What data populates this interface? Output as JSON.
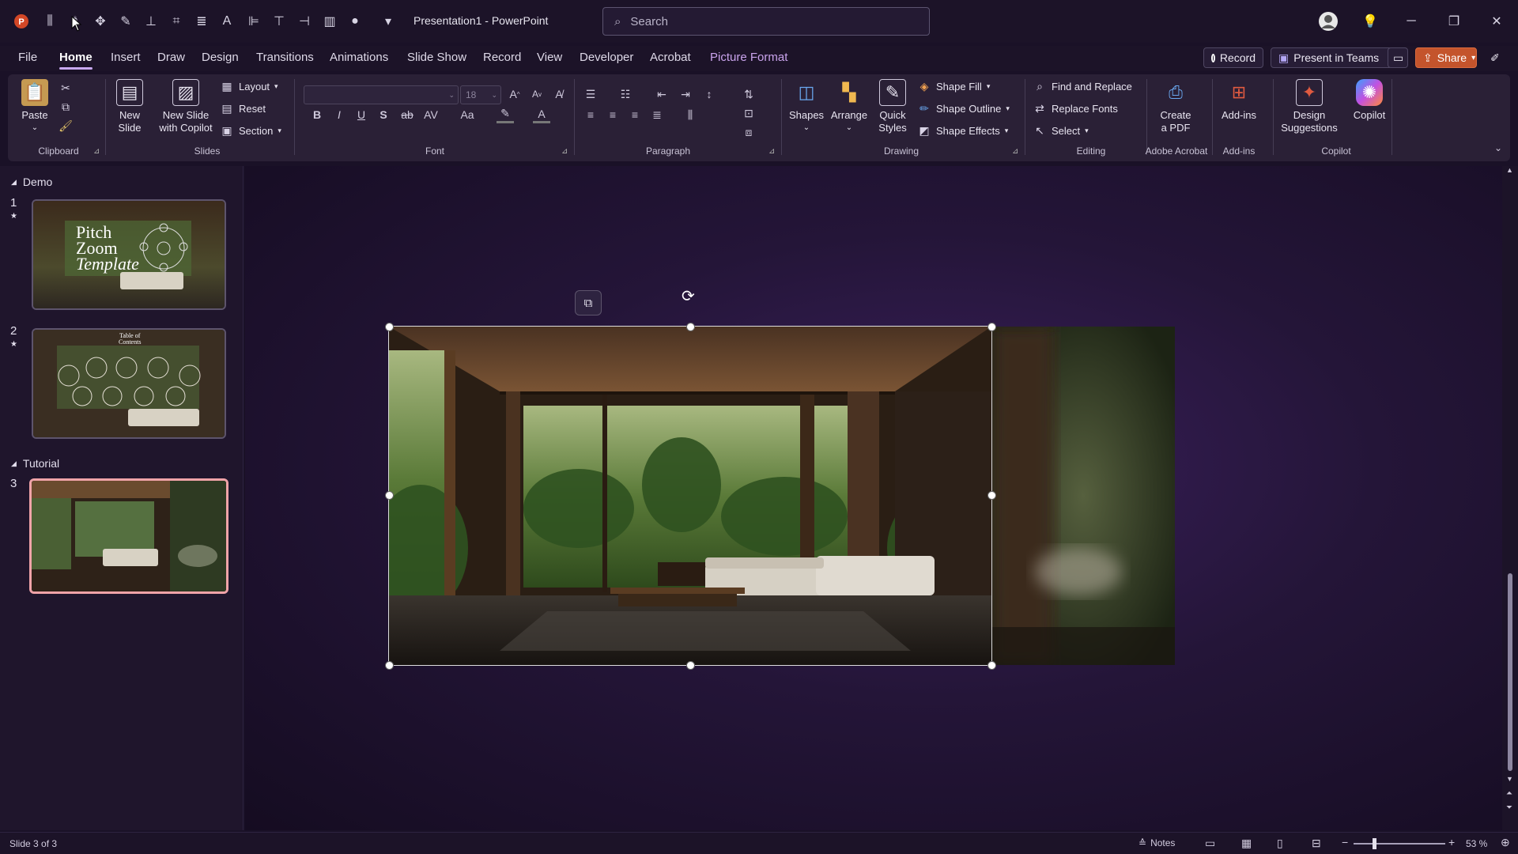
{
  "app": {
    "doc_title": "Presentation1 - PowerPoint",
    "search_placeholder": "Search",
    "brand_color": "#c4542c"
  },
  "quick_access": [
    "powerpoint-logo",
    "distribute-icon",
    "align-icon",
    "move-icon",
    "format-icon",
    "align-bottom-icon",
    "crop-icon",
    "text-align-icon",
    "text-icon",
    "align-left-icon",
    "align-top-icon",
    "align-right-icon",
    "chart-icon",
    "shape-icon",
    "customize-icon"
  ],
  "tabs": {
    "file": "File",
    "home": "Home",
    "insert": "Insert",
    "draw": "Draw",
    "design": "Design",
    "transitions": "Transitions",
    "animations": "Animations",
    "slideshow": "Slide Show",
    "record": "Record",
    "view": "View",
    "developer": "Developer",
    "acrobat": "Acrobat",
    "picture_format": "Picture Format"
  },
  "top_buttons": {
    "record": "Record",
    "present_teams": "Present in Teams",
    "share": "Share"
  },
  "ribbon": {
    "clipboard": {
      "paste": "Paste",
      "label": "Clipboard"
    },
    "slides": {
      "new_slide": "New Slide",
      "new_slide_copilot_1": "New Slide",
      "new_slide_copilot_2": "with Copilot",
      "layout": "Layout",
      "reset": "Reset",
      "section": "Section",
      "label": "Slides"
    },
    "font": {
      "size": "18",
      "label": "Font"
    },
    "paragraph": {
      "label": "Paragraph"
    },
    "drawing": {
      "shapes": "Shapes",
      "arrange": "Arrange",
      "quick_styles_1": "Quick",
      "quick_styles_2": "Styles",
      "shape_fill": "Shape Fill",
      "shape_outline": "Shape Outline",
      "shape_effects": "Shape Effects",
      "label": "Drawing"
    },
    "editing": {
      "find_replace": "Find and Replace",
      "replace_fonts": "Replace Fonts",
      "select": "Select",
      "label": "Editing"
    },
    "adobe": {
      "create_pdf_1": "Create",
      "create_pdf_2": "a PDF",
      "label": "Adobe Acrobat"
    },
    "addins": {
      "addins": "Add-ins",
      "label": "Add-ins"
    },
    "copilot": {
      "design_1": "Design",
      "design_2": "Suggestions",
      "copilot": "Copilot",
      "label": "Copilot"
    }
  },
  "slides_panel": {
    "section1": "Demo",
    "section2": "Tutorial",
    "slides": [
      {
        "num": "1",
        "title_lines": [
          "Pitch",
          "Zoom",
          "Template"
        ]
      },
      {
        "num": "2",
        "title_lines": [
          "Table of",
          "Contents"
        ]
      },
      {
        "num": "3"
      }
    ]
  },
  "status": {
    "slide_counter": "Slide 3 of 3",
    "notes": "Notes",
    "zoom": "53 %"
  }
}
